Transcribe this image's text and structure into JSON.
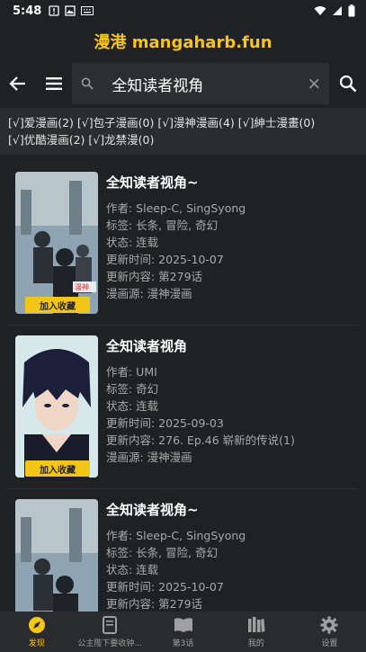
{
  "status": {
    "time": "5:48"
  },
  "brand": "漫港 mangaharb.fun",
  "search": {
    "value": "全知读者视角"
  },
  "sources": [
    "[√]爱漫画(2)",
    "[√]包子漫画(0)",
    "[√]漫神漫画(4)",
    "[√]紳士漫畫(0)",
    "[√]优酷漫画(2)",
    "[√]龙禁漫(0)"
  ],
  "results": [
    {
      "title": "全知读者视角~",
      "author": "作者: Sleep-C, SingSyong",
      "tags": "标签: 长条, 冒险, 奇幻",
      "state": "状态: 连载",
      "updated": "更新时间: 2025-10-07",
      "content": "更新内容: 第279话",
      "source": "漫画源: 漫神漫画",
      "fav": "加入收藏"
    },
    {
      "title": "全知读者视角",
      "author": "作者: UMI",
      "tags": "标签: 奇幻",
      "state": "状态: 连载",
      "updated": "更新时间: 2025-09-03",
      "content": "更新内容: 276. Ep.46 崭新的传说(1)",
      "source": "漫画源: 漫神漫画",
      "fav": "加入收藏"
    },
    {
      "title": "全知读者视角~",
      "author": "作者: Sleep-C, SingSyong",
      "tags": "标签: 长条, 冒险, 奇幻",
      "state": "状态: 连载",
      "updated": "更新时间: 2025-10-07",
      "content": "更新内容: 第279话",
      "source": "",
      "fav": ""
    }
  ],
  "nav": [
    {
      "label": "发现",
      "icon": "compass-icon",
      "active": true
    },
    {
      "label": "公主陛下要收钟...",
      "icon": "book-icon",
      "active": false
    },
    {
      "label": "第3话",
      "icon": "open-book-icon",
      "active": false
    },
    {
      "label": "我的",
      "icon": "library-icon",
      "active": false
    },
    {
      "label": "设置",
      "icon": "gear-icon",
      "active": false
    }
  ],
  "colors": {
    "accent": "#f5c518",
    "background": "#202124"
  }
}
